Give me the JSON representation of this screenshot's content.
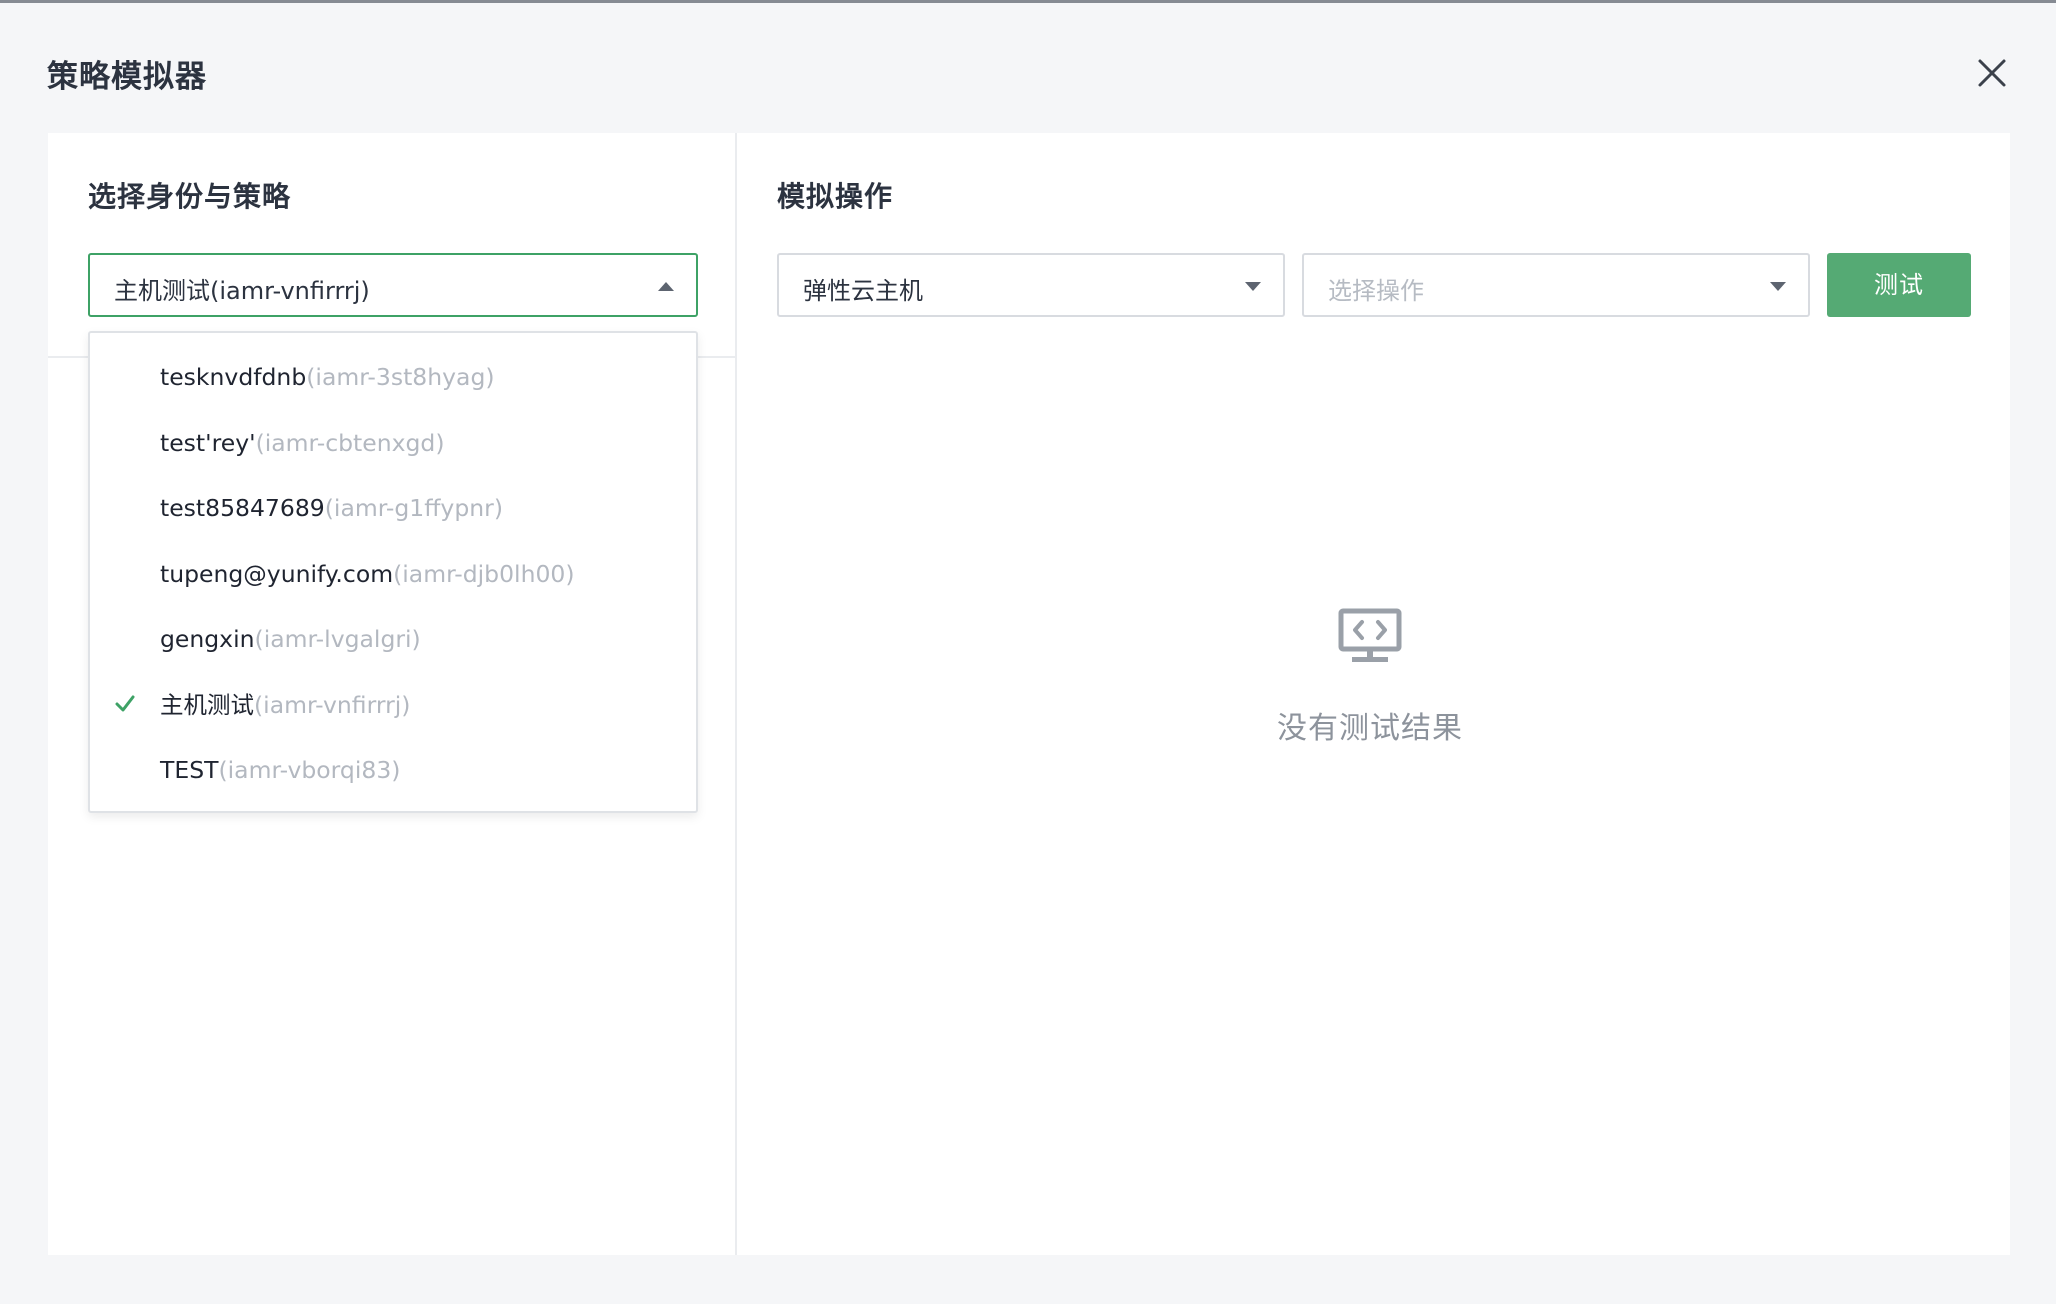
{
  "dialog": {
    "title": "策略模拟器"
  },
  "left": {
    "title": "选择身份与策略",
    "identity_select": {
      "value": "主机测试(iamr-vnfirrrj)",
      "expanded": true
    },
    "options": [
      {
        "name": "tesknvdfdnb",
        "id": "(iamr-3st8hyag)",
        "selected": false
      },
      {
        "name": "test'rey'",
        "id": "(iamr-cbtenxgd)",
        "selected": false
      },
      {
        "name": "test85847689",
        "id": "(iamr-g1ffypnr)",
        "selected": false
      },
      {
        "name": "tupeng@yunify.com",
        "id": "(iamr-djb0lh00)",
        "selected": false
      },
      {
        "name": "gengxin",
        "id": "(iamr-lvgalgri)",
        "selected": false
      },
      {
        "name": "主机测试",
        "id": "(iamr-vnfirrrj)",
        "selected": true
      },
      {
        "name": "TEST",
        "id": "(iamr-vborqi83)",
        "selected": false
      }
    ]
  },
  "right": {
    "title": "模拟操作",
    "service_select": {
      "value": "弹性云主机"
    },
    "action_select": {
      "placeholder": "选择操作"
    },
    "test_button": "测试",
    "empty_text": "没有测试结果"
  },
  "colors": {
    "accent": "#55aa74",
    "check": "#3ea266",
    "border": "#d8dbe0",
    "muted": "#b3b8c0"
  },
  "icons": {
    "close": "close-icon",
    "empty": "code-monitor-icon",
    "check": "check-icon"
  }
}
